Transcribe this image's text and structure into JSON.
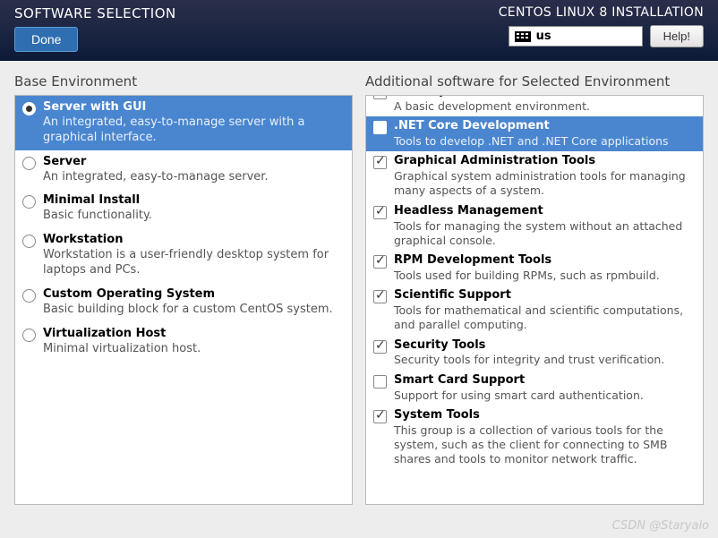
{
  "header": {
    "page_title": "SOFTWARE SELECTION",
    "done_label": "Done",
    "installer_title": "CENTOS LINUX 8 INSTALLATION",
    "keyboard_layout": "us",
    "help_label": "Help!"
  },
  "base": {
    "heading": "Base Environment",
    "items": [
      {
        "title": "Server with GUI",
        "desc": "An integrated, easy-to-manage server with a graphical interface.",
        "selected": true
      },
      {
        "title": "Server",
        "desc": "An integrated, easy-to-manage server.",
        "selected": false
      },
      {
        "title": "Minimal Install",
        "desc": "Basic functionality.",
        "selected": false
      },
      {
        "title": "Workstation",
        "desc": "Workstation is a user-friendly desktop system for laptops and PCs.",
        "selected": false
      },
      {
        "title": "Custom Operating System",
        "desc": "Basic building block for a custom CentOS system.",
        "selected": false
      },
      {
        "title": "Virtualization Host",
        "desc": "Minimal virtualization host.",
        "selected": false
      }
    ]
  },
  "addons": {
    "heading": "Additional software for Selected Environment",
    "items": [
      {
        "title": "Development Tools",
        "desc": "A basic development environment.",
        "checked": true,
        "highlight": false
      },
      {
        "title": ".NET Core Development",
        "desc": "Tools to develop .NET and .NET Core applications",
        "checked": false,
        "highlight": true
      },
      {
        "title": "Graphical Administration Tools",
        "desc": "Graphical system administration tools for managing many aspects of a system.",
        "checked": true,
        "highlight": false
      },
      {
        "title": "Headless Management",
        "desc": "Tools for managing the system without an attached graphical console.",
        "checked": true,
        "highlight": false
      },
      {
        "title": "RPM Development Tools",
        "desc": "Tools used for building RPMs, such as rpmbuild.",
        "checked": true,
        "highlight": false
      },
      {
        "title": "Scientific Support",
        "desc": "Tools for mathematical and scientific computations, and parallel computing.",
        "checked": true,
        "highlight": false
      },
      {
        "title": "Security Tools",
        "desc": "Security tools for integrity and trust verification.",
        "checked": true,
        "highlight": false
      },
      {
        "title": "Smart Card Support",
        "desc": "Support for using smart card authentication.",
        "checked": false,
        "highlight": false
      },
      {
        "title": "System Tools",
        "desc": "This group is a collection of various tools for the system, such as the client for connecting to SMB shares and tools to monitor network traffic.",
        "checked": true,
        "highlight": false
      }
    ]
  },
  "watermark": "CSDN @Staryalo"
}
